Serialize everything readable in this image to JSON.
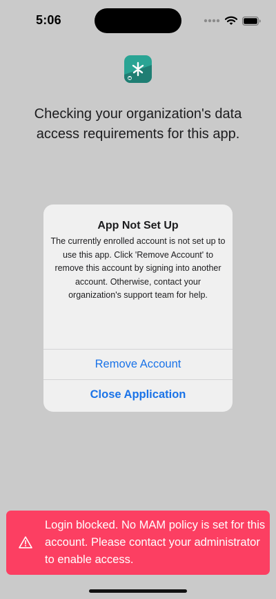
{
  "status_bar": {
    "time": "5:06",
    "icons": [
      "signal-dots-icon",
      "wifi-icon",
      "battery-icon"
    ]
  },
  "app_icon": {
    "name": "intune-app-icon",
    "colors": {
      "primary": "#2aa494",
      "secondary": "#1f7e73"
    }
  },
  "checking": {
    "text": "Checking your organization's data access requirements for this app."
  },
  "alert": {
    "title": "App Not Set Up",
    "message": "The currently enrolled account  is not set up to use this app. Click 'Remove Account' to remove this account by signing into another account. Otherwise, contact your organization's support team for help.",
    "buttons": [
      {
        "label": "Remove Account",
        "style": "default"
      },
      {
        "label": "Close Application",
        "style": "bold"
      }
    ]
  },
  "toast": {
    "icon": "warning-icon",
    "text": "Login blocked. No MAM policy is set for this account. Please contact your administrator to enable access.",
    "color": "#fc3f62"
  },
  "colors": {
    "background": "#cacaca",
    "alert_background": "#f0f0f0",
    "accent": "#1a73e8",
    "toast": "#fc3f62"
  }
}
